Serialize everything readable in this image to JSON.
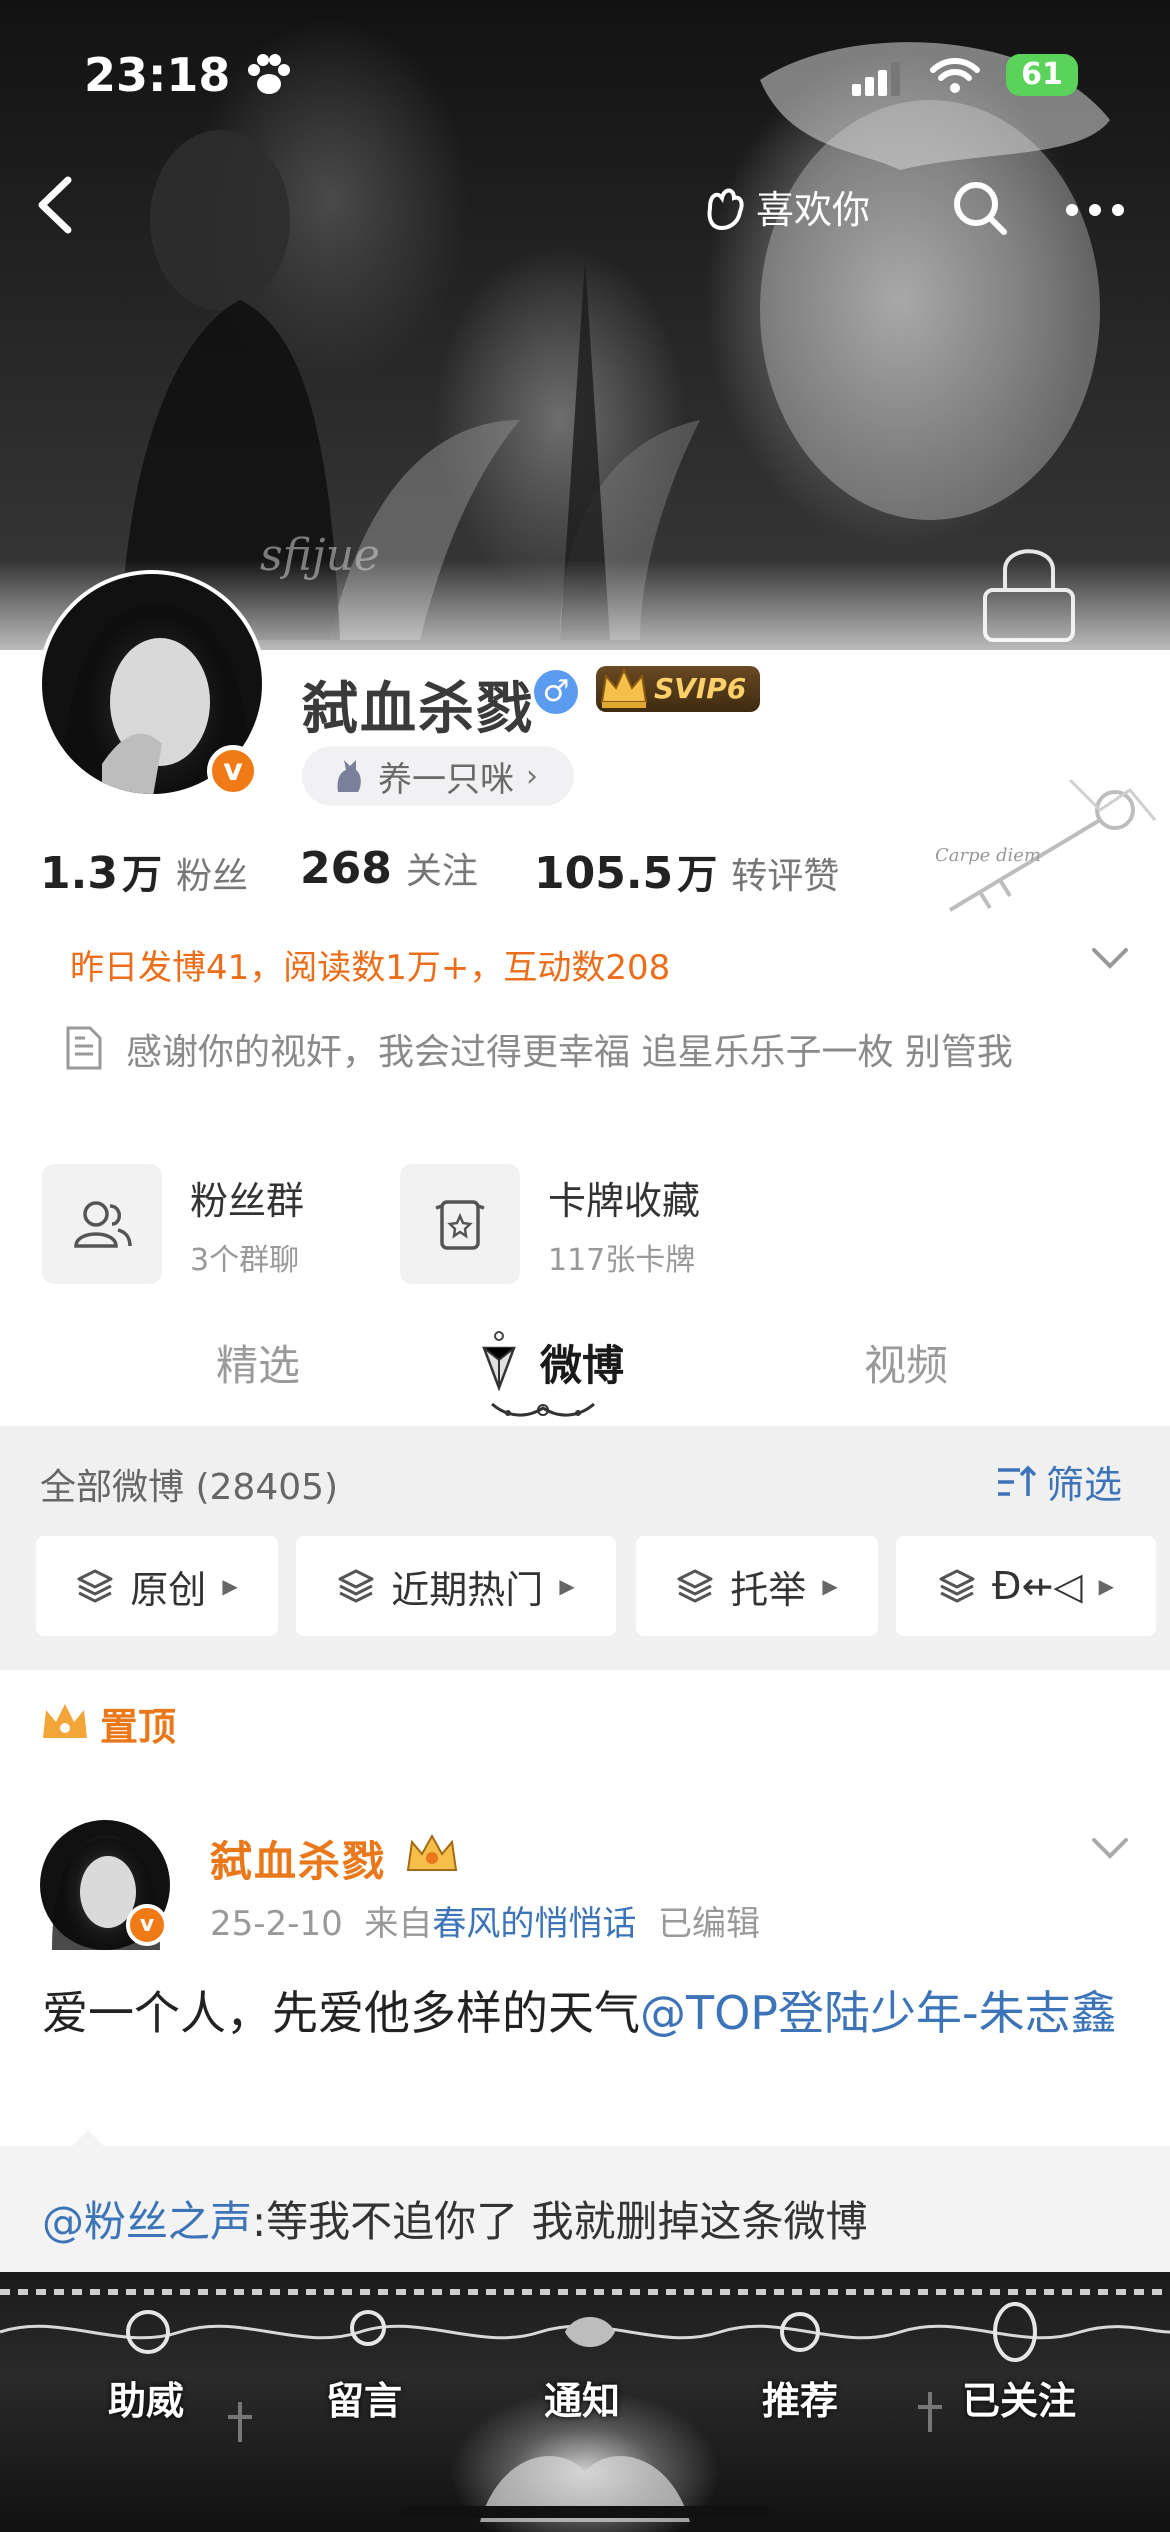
{
  "status_bar": {
    "time": "23:18",
    "battery": "61"
  },
  "header": {
    "like_label": "喜欢你"
  },
  "profile": {
    "name": "弑血杀戮",
    "gender_symbol": "♂",
    "svip": "SVIP6",
    "verified_mark": "v",
    "cat_pill": "养一只咪",
    "stats": [
      {
        "num": "1.3",
        "unit": "万",
        "label": "粉丝"
      },
      {
        "num": "268",
        "unit": "",
        "label": "关注"
      },
      {
        "num": "105.5",
        "unit": "万",
        "label": "转评赞"
      }
    ],
    "yesterday": "昨日发博41，阅读数1万+，互动数208",
    "bio": "感谢你的视奸，我会过得更幸福  追星乐乐子一枚 别管我",
    "deco_text": "Carpe diem",
    "cards": [
      {
        "title": "粉丝群",
        "sub": "3个群聊",
        "icon": "people-icon"
      },
      {
        "title": "卡牌收藏",
        "sub": "117张卡牌",
        "icon": "card-icon"
      }
    ]
  },
  "tabs": [
    "精选",
    "微博",
    "视频"
  ],
  "feed_header": {
    "all_label": "全部微博",
    "count": "(28405)",
    "filter_label": "筛选"
  },
  "chips": [
    "原创",
    "近期热门",
    "托举",
    "Ð⇷◁"
  ],
  "pinned": {
    "label": "置顶",
    "author": "弑血杀戮",
    "date": "25-2-10",
    "from_prefix": "来自",
    "source": "春风的悄悄话",
    "edited": "已编辑",
    "body_text": "爱一个人，先爱他多样的天气",
    "body_mention": "@TOP登陆少年-朱志鑫",
    "quote_mention": "@粉丝之声",
    "quote_text": ":等我不追你了 我就删掉这条微博"
  },
  "bottom_bar": [
    "助威",
    "留言",
    "通知",
    "推荐",
    "已关注"
  ],
  "colors": {
    "accent_orange": "#ec6d1a",
    "link_blue": "#3d74b8",
    "verified": "#f07a16"
  }
}
